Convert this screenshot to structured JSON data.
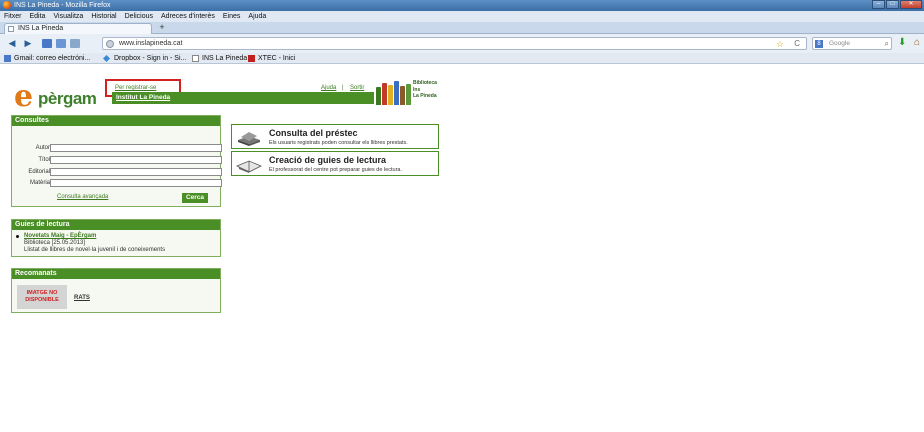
{
  "window": {
    "title": "INS La Pineda - Mozilla Firefox",
    "min": "–",
    "max": "□",
    "close": "✕"
  },
  "menu": [
    "Fitxer",
    "Edita",
    "Visualitza",
    "Historial",
    "Delicious",
    "Adreces d'interès",
    "Eines",
    "Ajuda"
  ],
  "tab": {
    "label": "INS La Pineda",
    "new_tab": "+"
  },
  "nav": {
    "back": "◀",
    "forward": "▶",
    "url": "www.inslapineda.cat",
    "star": "☆",
    "reload": "C",
    "search_engine": "8",
    "search_placeholder": "Google",
    "search_icon": "⌕",
    "download": "⬇",
    "home": "⌂"
  },
  "bookmarks": [
    {
      "label": "Gmail: correo electróni...",
      "color": "#4a78c8"
    },
    {
      "label": "Dropbox - Sign in - Si...",
      "color": "#3a8ad8"
    },
    {
      "label": "INS La Pineda",
      "color": "#ffffff"
    },
    {
      "label": "XTEC - Inici",
      "color": "#c02020"
    }
  ],
  "header": {
    "logo_e": "e",
    "logo_rest": "pèrgam",
    "register_link": "Per registrar-se",
    "help_link": "Ajuda",
    "separator": "|",
    "exit_link": "Sortir",
    "institute": "Institut La Pineda",
    "library": [
      "Biblioteca",
      "Ins",
      "La Pineda"
    ]
  },
  "consultes": {
    "heading": "Consultes",
    "fields": [
      {
        "label": "Autor",
        "value": ""
      },
      {
        "label": "Títol",
        "value": ""
      },
      {
        "label": "Editorial",
        "value": ""
      },
      {
        "label": "Matèria",
        "value": ""
      }
    ],
    "advanced_link": "Consulta avançada",
    "search_button": "Cerca"
  },
  "guies": {
    "heading": "Guies de lectura",
    "item_title": "Novetats Maig - EpÈrgam",
    "item_date": "Biblioteca [25.05.2013]",
    "item_desc": "Llistat de llibres de novel·la juvenil i de coneixements"
  },
  "recomanats": {
    "heading": "Recomanats",
    "image_text": "IMATGE NO DISPONIBLE",
    "title": "RATS"
  },
  "cards": [
    {
      "title": "Consulta del préstec",
      "desc": "Els usuaris registrats poden consultar els llibres prestats."
    },
    {
      "title": "Creació de guies de lectura",
      "desc": "El professorat del centre pot preparar guies de lectura."
    }
  ],
  "colors": {
    "brand_green": "#4a8e26",
    "brand_orange": "#e07a18",
    "highlight_red": "#d32020"
  }
}
